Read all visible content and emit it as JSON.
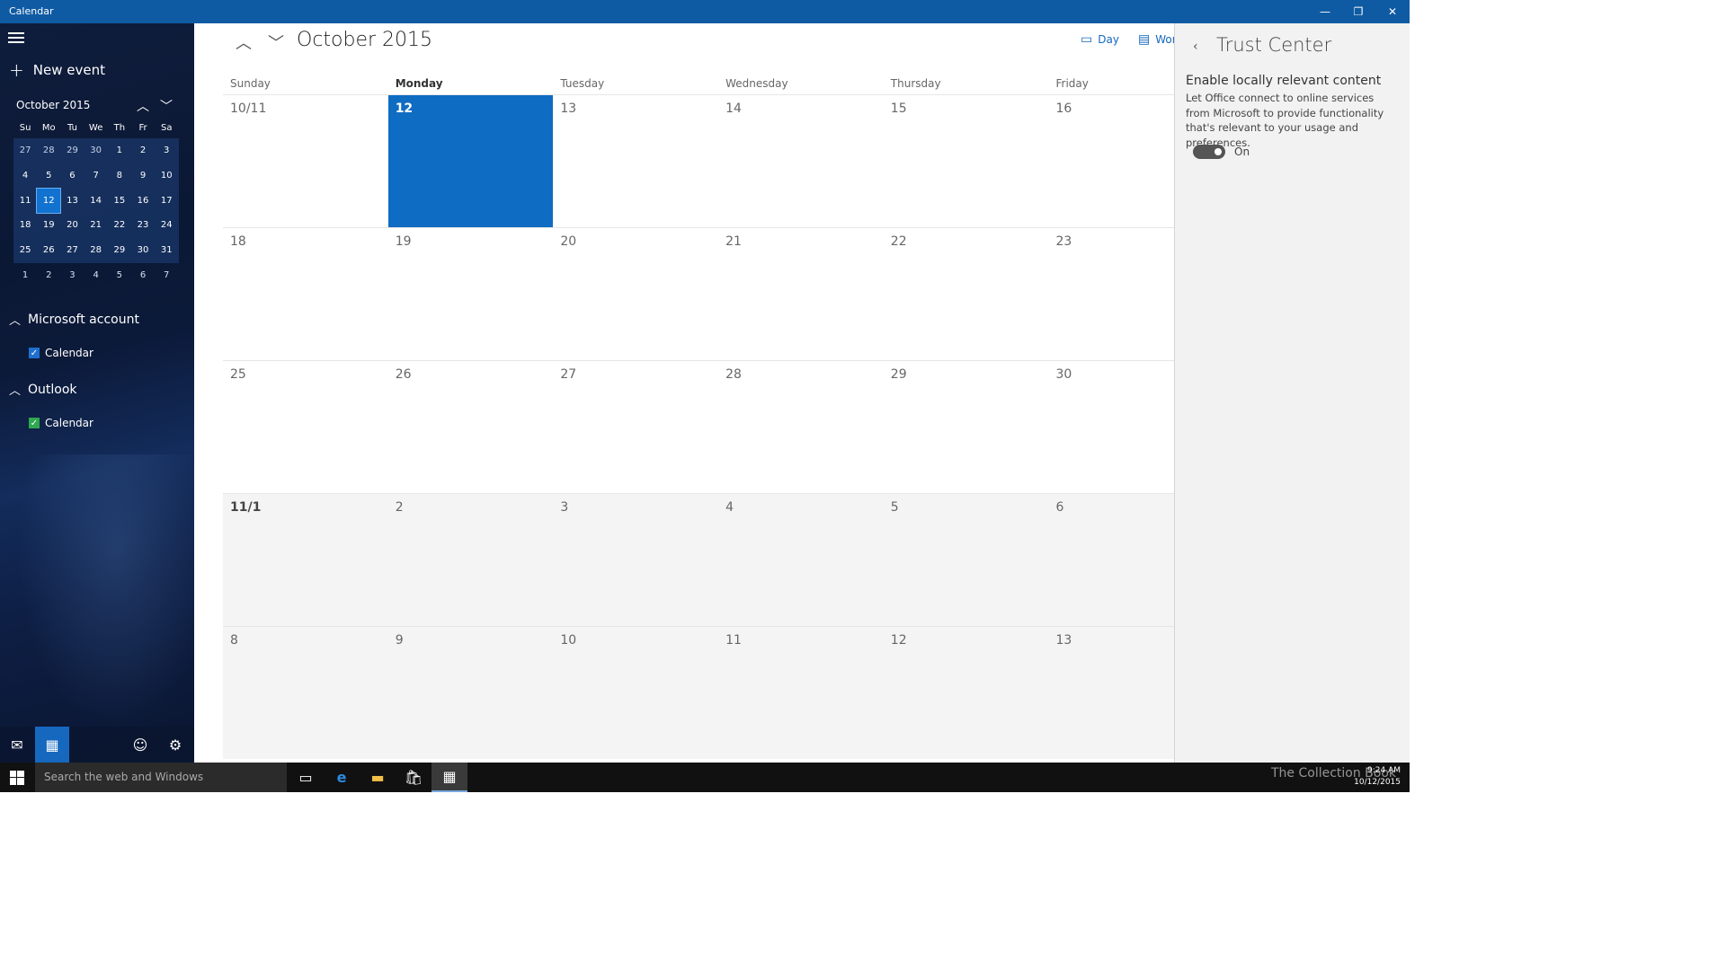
{
  "window": {
    "title": "Calendar",
    "minimize": "—",
    "restore": "❐",
    "close": "✕"
  },
  "sidebar": {
    "new_event": "New event",
    "mini_month": "October 2015",
    "weekday_abbrev": [
      "Su",
      "Mo",
      "Tu",
      "We",
      "Th",
      "Fr",
      "Sa"
    ],
    "weeks": [
      [
        "27",
        "28",
        "29",
        "30",
        "1",
        "2",
        "3"
      ],
      [
        "4",
        "5",
        "6",
        "7",
        "8",
        "9",
        "10"
      ],
      [
        "11",
        "12",
        "13",
        "14",
        "15",
        "16",
        "17"
      ],
      [
        "18",
        "19",
        "20",
        "21",
        "22",
        "23",
        "24"
      ],
      [
        "25",
        "26",
        "27",
        "28",
        "29",
        "30",
        "31"
      ],
      [
        "1",
        "2",
        "3",
        "4",
        "5",
        "6",
        "7"
      ]
    ],
    "accounts": [
      {
        "name": "Microsoft account",
        "calendar": "Calendar",
        "color": "#1e6fd0"
      },
      {
        "name": "Outlook",
        "calendar": "Calendar",
        "color": "#2fa84f"
      }
    ]
  },
  "main": {
    "month_title": "October 2015",
    "view_day": "Day",
    "view_work": "Wor",
    "day_headers": [
      "Sunday",
      "Monday",
      "Tuesday",
      "Wednesday",
      "Thursday",
      "Friday"
    ],
    "weeks": [
      [
        "10/11",
        "12",
        "13",
        "14",
        "15",
        "16"
      ],
      [
        "18",
        "19",
        "20",
        "21",
        "22",
        "23"
      ],
      [
        "25",
        "26",
        "27",
        "28",
        "29",
        "30"
      ],
      [
        "11/1",
        "2",
        "3",
        "4",
        "5",
        "6"
      ],
      [
        "8",
        "9",
        "10",
        "11",
        "12",
        "13"
      ]
    ],
    "accent_color": "#0f6cc3"
  },
  "panel": {
    "title": "Trust Center",
    "setting_title": "Enable locally relevant content",
    "setting_desc": "Let Office connect to online services from Microsoft to provide functionality that's relevant to your usage and preferences.",
    "toggle_label": "On"
  },
  "taskbar": {
    "search_placeholder": "Search the web and Windows",
    "time": "9:24 AM",
    "date": "10/12/2015",
    "watermark": "The Collection Book"
  }
}
